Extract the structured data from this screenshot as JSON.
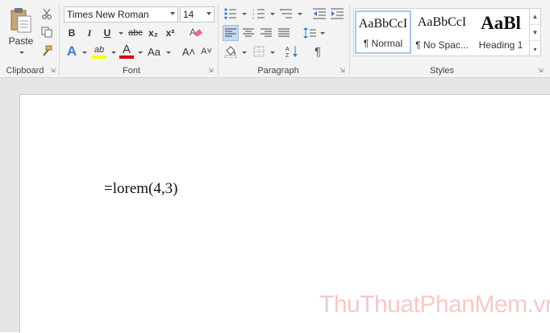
{
  "clipboard": {
    "paste_label": "Paste",
    "group_label": "Clipboard"
  },
  "font": {
    "name_value": "Times New Roman",
    "size_value": "14",
    "bold": "B",
    "italic": "I",
    "underline": "U",
    "strikethrough": "abc",
    "subscript": "x₂",
    "superscript": "x²",
    "grow": "A˄",
    "shrink": "A˅",
    "effects": "A",
    "highlight": "ab",
    "font_color": "A",
    "case": "Aa",
    "group_label": "Font"
  },
  "paragraph": {
    "group_label": "Paragraph",
    "pilcrow": "¶"
  },
  "styles": {
    "group_label": "Styles",
    "items": [
      {
        "sample": "AaBbCcI",
        "name": "¶ Normal"
      },
      {
        "sample": "AaBbCcI",
        "name": "¶ No Spac..."
      },
      {
        "sample": "AaBl",
        "name": "Heading 1"
      }
    ]
  },
  "document": {
    "text": "=lorem(4,3)"
  },
  "watermark": {
    "text": "ThuThuatPhanMem.vn"
  },
  "colors": {
    "highlight_bar": "#ffff00",
    "font_color_bar": "#d40000",
    "selected_style": "#a9c7ec"
  }
}
